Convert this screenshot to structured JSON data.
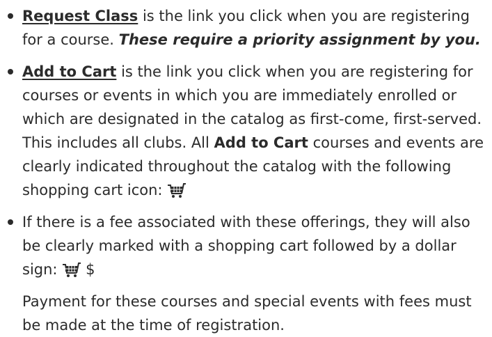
{
  "bullets": [
    {
      "link_text": "Request Class",
      "text_after_link": " is the link you click when you are registering for a course. ",
      "emphasis": "These require a priority assignment by you."
    },
    {
      "link_text": "Add to Cart",
      "text_after_link": " is the link you click when you are registering for courses or events in which you are immediately enrolled or which are designated in the catalog as first-come, first-served. This includes all clubs. All ",
      "bold_inline": "Add to Cart",
      "text_after_bold": " courses and events are clearly indicated throughout the catalog with the following shopping cart icon: ",
      "icon": "shopping-cart-icon"
    },
    {
      "text": "If there is a fee associated with these offerings, they will also be clearly marked with a shopping cart followed by a dollar sign: ",
      "icon": "shopping-cart-icon",
      "dollar_sign": "$"
    }
  ],
  "continuation_paragraph": "Payment for these courses and special events with fees must be made at the time of registration.",
  "colors": {
    "text": "#2b2b2b",
    "background": "#ffffff"
  }
}
